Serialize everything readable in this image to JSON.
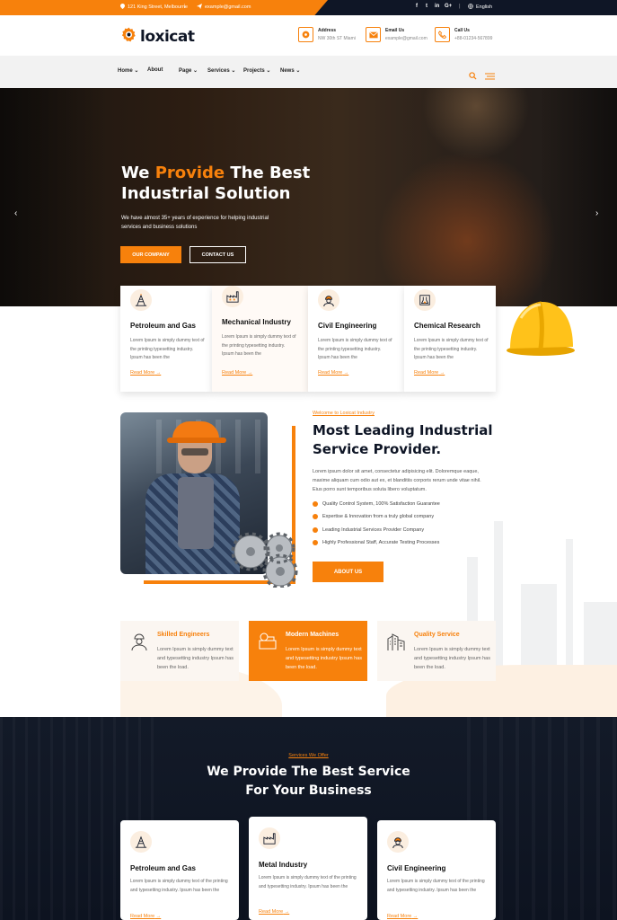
{
  "topbar": {
    "address": "121 King Street, Melbourne",
    "email": "example@gmail.com",
    "social": [
      "f",
      "t",
      "in",
      "G+"
    ],
    "language": "English"
  },
  "header": {
    "logo": "loxicat",
    "address_label": "Address",
    "address_value": "NW 30th ST Miami",
    "email_label": "Email Us",
    "email_value": "example@gmail.com",
    "call_label": "Call Us",
    "call_value": "+88-01234-567899"
  },
  "nav": [
    "Home",
    "About",
    "Page",
    "Services",
    "Projects",
    "News"
  ],
  "hero": {
    "title_part1": "We ",
    "title_highlight": "Provide",
    "title_part2": " The Best",
    "title_line2": "Industrial Solution",
    "subtitle": "We have almost 35+ years of experience for helping industrial services and business solutions",
    "btn_primary": "OUR COMPANY",
    "btn_secondary": "CONTACT US"
  },
  "service_cards": [
    {
      "title": "Petroleum and Gas",
      "text": "Lorem Ipsum is simply dummy text of the printing typesetting industry. Ipsum has been the",
      "link": "Read More"
    },
    {
      "title": "Mechanical Industry",
      "text": "Lorem Ipsum is simply dummy text of the printing typesetting industry. Ipsum has been the",
      "link": "Read More"
    },
    {
      "title": "Civil Engineering",
      "text": "Lorem Ipsum is simply dummy text of the printing typesetting industry. Ipsum has been the",
      "link": "Read More"
    },
    {
      "title": "Chemical Research",
      "text": "Lorem Ipsum is simply dummy text of the printing typesetting industry. Ipsum has been the",
      "link": "Read More"
    }
  ],
  "about": {
    "tag": "Welcome to Loxicat Industry",
    "title_line1": "Most Leading Industrial",
    "title_line2": "Service Provider.",
    "text": "Lorem ipsum dolor sit amet, consectetur adipisicing elit. Doloremque eaque, maxime aliquam cum odio aut ex, et blanditiis corporis rerum unde vitae nihil. Eius porro sunt temporibus soluta libero voluptatum.",
    "list": [
      "Quality Control System, 100% Satisfaction Guarantee",
      "Expertise & Innovation from a truly global company",
      "Leading Industrial Services Provider Company",
      "Highly Professional Staff, Accurate Testing Processes"
    ],
    "button": "ABOUT US"
  },
  "features": [
    {
      "title": "Skilled Engineers",
      "text": "Lorem Ipsum is simply dummy text and typesetting industry Ipsum has been the load."
    },
    {
      "title": "Modern Machines",
      "text": "Lorem Ipsum is simply dummy text and typesetting industry Ipsum has been the load."
    },
    {
      "title": "Quality Service",
      "text": "Lorem Ipsum is simply dummy text and typesetting industry Ipsum has been the load."
    }
  ],
  "services": {
    "tag": "Services We Offer",
    "title_line1": "We Provide The Best Service",
    "title_line2": "For Your Business",
    "cards": [
      {
        "title": "Petroleum and Gas",
        "text": "Lorem Ipsum is simply dummy text of the printing and typesetting industry. Ipsum has been the",
        "link": "Read More"
      },
      {
        "title": "Metal Industry",
        "text": "Lorem Ipsum is simply dummy text of the printing and typesetting industry. Ipsum has been the",
        "link": "Read More"
      },
      {
        "title": "Civil Engineering",
        "text": "Lorem Ipsum is simply dummy text of the printing and typesetting industry. Ipsum has been the",
        "link": "Read More"
      }
    ]
  },
  "colors": {
    "accent": "#f7810c",
    "dark": "#0f1626"
  }
}
